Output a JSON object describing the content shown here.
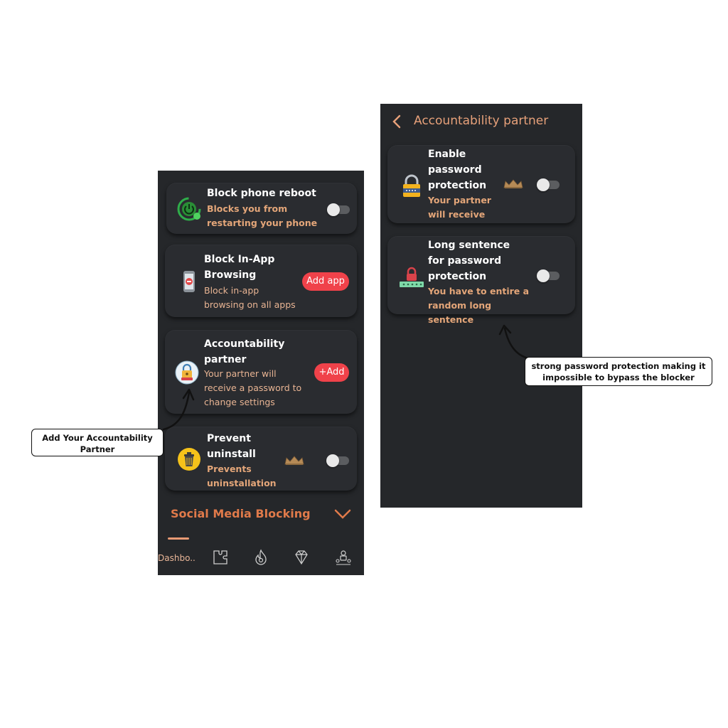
{
  "left_screen": {
    "items": [
      {
        "title": "Block phone reboot",
        "subtitle": "Blocks you from restarting your phone",
        "icon": "power-phone-icon",
        "control": "toggle",
        "toggle_on": false
      },
      {
        "title": "Block In-App Browsing",
        "subtitle": "Block in-app browsing on all apps",
        "icon": "phone-block-icon",
        "control": "button",
        "button_label": "Add app"
      },
      {
        "title": "Accountability partner",
        "subtitle": "Your partner will receive a password to change settings",
        "icon": "partner-lock-icon",
        "control": "button",
        "button_label": "+Add"
      },
      {
        "title": "Prevent uninstall",
        "subtitle": "Prevents uninstallation",
        "icon": "trash-icon",
        "control": "toggle",
        "toggle_on": false,
        "premium": true
      }
    ],
    "section_title": "Social Media Blocking",
    "nav": {
      "dashboard_label": "Dashbo...",
      "icons": [
        "puzzle-icon",
        "flame-icon",
        "diamond-icon",
        "community-icon"
      ]
    }
  },
  "right_screen": {
    "header_title": "Accountability partner",
    "items": [
      {
        "title": "Enable password protection",
        "subtitle": "Your partner will receive",
        "icon": "padlock-icon",
        "toggle_on": false,
        "premium": true
      },
      {
        "title": "Long sentence for password protection",
        "subtitle": "You have to entire a random long sentence",
        "icon": "password-field-icon",
        "toggle_on": false
      }
    ]
  },
  "callouts": {
    "left": "Add Your Accountability Partner",
    "right": "strong password protection making it impossible to bypass the blocker"
  },
  "colors": {
    "screen_bg": "#25272a",
    "accent_orange": "#e07a4a",
    "accent_peach": "#e8b493",
    "button_red": "#f0424a"
  }
}
